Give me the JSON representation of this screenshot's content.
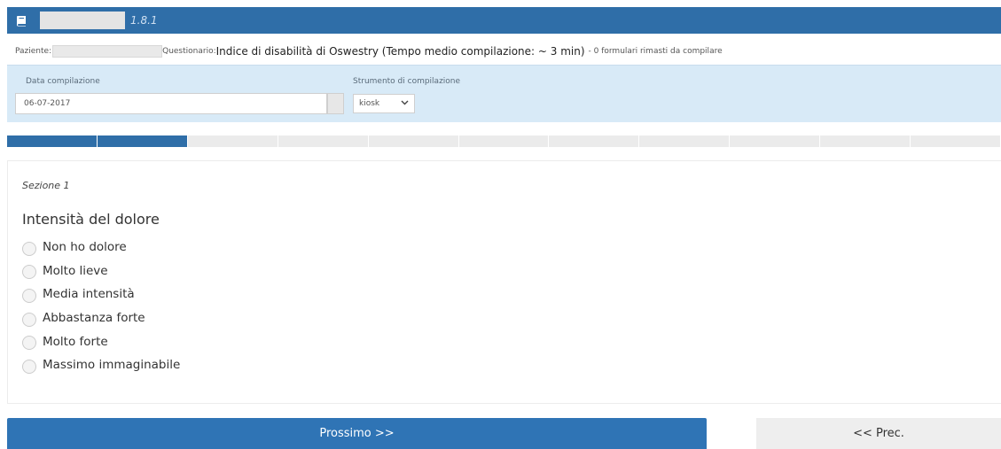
{
  "header": {
    "app_version": "1.8.1",
    "icon": "book-icon"
  },
  "info": {
    "patient_label": "Paziente:",
    "questionnaire_label": "Questionario:",
    "questionnaire_title": "Indice di disabilità di Oswestry (Tempo medio compilazione: ~ 3 min)",
    "remaining": "- 0 formulari rimasti da compilare"
  },
  "form": {
    "date_label": "Data compilazione",
    "date_value": "06-07-2017",
    "tool_label": "Strumento di compilazione",
    "tool_value": "kiosk"
  },
  "progress": {
    "total_steps": 11,
    "completed_steps": 2
  },
  "question": {
    "section": "Sezione 1",
    "title": "Intensità del dolore",
    "options": [
      "Non ho dolore",
      "Molto lieve",
      "Media intensità",
      "Abbastanza forte",
      "Molto forte",
      "Massimo immaginabile"
    ]
  },
  "nav": {
    "next_label": "Prossimo >>",
    "prev_label": "<< Prec."
  },
  "colors": {
    "primary": "#2f6ea8",
    "panel": "#d8eaf7",
    "progress_empty": "#ebebeb"
  }
}
